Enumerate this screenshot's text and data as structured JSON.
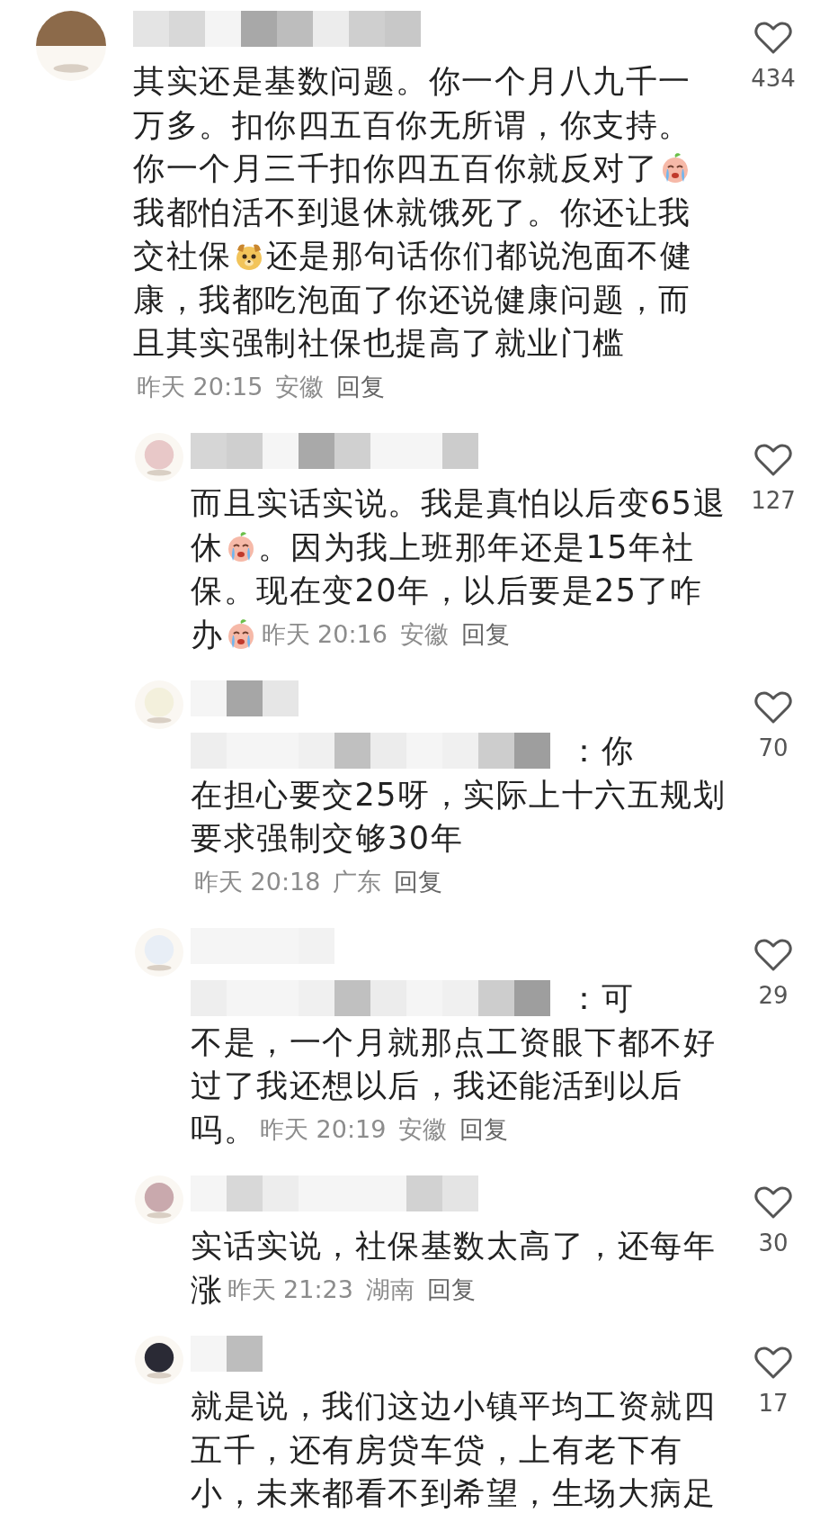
{
  "comments": [
    {
      "kind": "top",
      "likes": "434",
      "lines": [
        [
          {
            "kind": "text",
            "text": "其实还是基数问题。你一个月八九千一"
          }
        ],
        [
          {
            "kind": "text",
            "text": "万多。扣你四五百你无所谓，你支持。"
          }
        ],
        [
          {
            "kind": "text",
            "text": "你一个月三千扣你四五百你就反对了"
          },
          {
            "kind": "crying_emoji"
          }
        ],
        [
          {
            "kind": "text",
            "text": "我都怕活不到退休就饿死了。你还让我"
          }
        ],
        [
          {
            "kind": "text",
            "text": "交社保"
          },
          {
            "kind": "dog_emoji"
          },
          {
            "kind": "text",
            "text": "还是那句话你们都说泡面不健"
          }
        ],
        [
          {
            "kind": "text",
            "text": "康，我都吃泡面了你还说健康问题，而"
          }
        ],
        [
          {
            "kind": "text",
            "text": "且其实强制社保也提高了就业门槛"
          }
        ],
        [
          {
            "kind": "time",
            "text": "昨天 20:15"
          },
          {
            "kind": "location",
            "text": "安徽"
          },
          {
            "kind": "reply",
            "text": "回复"
          }
        ]
      ]
    },
    {
      "kind": "reply",
      "likes": "127",
      "lines": [
        [
          {
            "kind": "text",
            "text": "而且实话实说。我是真怕以后变65退"
          }
        ],
        [
          {
            "kind": "text",
            "text": "休"
          },
          {
            "kind": "crying_emoji"
          },
          {
            "kind": "text",
            "text": "。因为我上班那年还是15年社"
          }
        ],
        [
          {
            "kind": "text",
            "text": "保。现在变20年，以后要是25了咋"
          }
        ],
        [
          {
            "kind": "text",
            "text": "办"
          },
          {
            "kind": "crying_emoji"
          },
          {
            "kind": "time",
            "text": "昨天 20:16"
          },
          {
            "kind": "location",
            "text": "安徽"
          },
          {
            "kind": "reply",
            "text": "回复"
          }
        ]
      ]
    },
    {
      "kind": "reply",
      "likes": "70",
      "lines": [
        [
          {
            "kind": "mention",
            "text": "：你"
          }
        ],
        [
          {
            "kind": "text",
            "text": "在担心要交25呀，实际上十六五规划"
          }
        ],
        [
          {
            "kind": "text",
            "text": "要求强制交够30年"
          }
        ],
        [
          {
            "kind": "time",
            "text": "昨天 20:18"
          },
          {
            "kind": "location",
            "text": "广东"
          },
          {
            "kind": "reply",
            "text": "回复"
          }
        ]
      ]
    },
    {
      "kind": "reply",
      "likes": "29",
      "lines": [
        [
          {
            "kind": "mention",
            "text": "：可"
          }
        ],
        [
          {
            "kind": "text",
            "text": "不是，一个月就那点工资眼下都不好"
          }
        ],
        [
          {
            "kind": "text",
            "text": "过了我还想以后，我还能活到以后"
          }
        ],
        [
          {
            "kind": "text",
            "text": "吗。"
          },
          {
            "kind": "time",
            "text": "昨天 20:19"
          },
          {
            "kind": "location",
            "text": "安徽"
          },
          {
            "kind": "reply",
            "text": "回复"
          }
        ]
      ]
    },
    {
      "kind": "reply",
      "likes": "30",
      "lines": [
        [
          {
            "kind": "text",
            "text": "实话实说，社保基数太高了，还每年"
          }
        ],
        [
          {
            "kind": "text",
            "text": "涨"
          },
          {
            "kind": "time",
            "text": "昨天 21:23"
          },
          {
            "kind": "location",
            "text": "湖南"
          },
          {
            "kind": "reply",
            "text": "回复"
          }
        ]
      ]
    },
    {
      "kind": "reply",
      "likes": "17",
      "lines": [
        [
          {
            "kind": "text",
            "text": "就是说，我们这边小镇平均工资就四"
          }
        ],
        [
          {
            "kind": "text",
            "text": "五千，还有房贷车贷，上有老下有"
          }
        ],
        [
          {
            "kind": "text",
            "text": "小，未来都看不到希望，生场大病足"
          }
        ]
      ]
    }
  ]
}
